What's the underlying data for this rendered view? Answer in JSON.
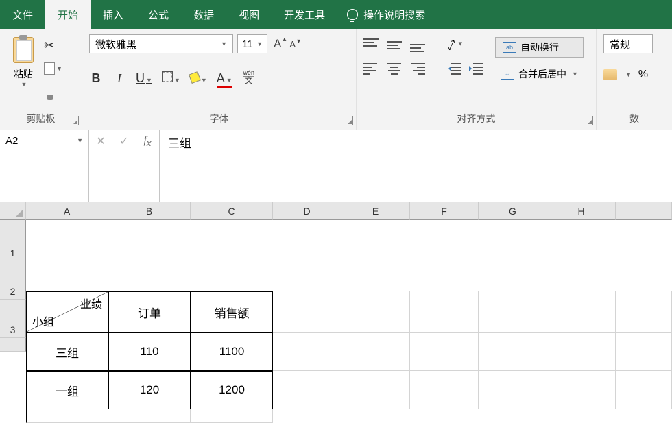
{
  "menu": {
    "items": [
      "文件",
      "开始",
      "插入",
      "公式",
      "数据",
      "视图",
      "开发工具"
    ],
    "active_index": 1,
    "search_placeholder": "操作说明搜索"
  },
  "ribbon": {
    "clipboard": {
      "paste": "粘贴",
      "label": "剪贴板"
    },
    "font": {
      "name": "微软雅黑",
      "size": "11",
      "bold": "B",
      "italic": "I",
      "underline": "U",
      "fontcolor_letter": "A",
      "wen": "wén",
      "wen_char": "文",
      "grow": "A",
      "shrink": "A",
      "label": "字体"
    },
    "alignment": {
      "wrap": "自动换行",
      "wrap_ic": "ab",
      "merge": "合并后居中",
      "label": "对齐方式"
    },
    "number": {
      "format": "常规",
      "percent": "%",
      "label": "数"
    }
  },
  "formula_bar": {
    "name_box": "A2",
    "value": "三组"
  },
  "grid": {
    "columns": [
      "A",
      "B",
      "C",
      "D",
      "E",
      "F",
      "G",
      "H",
      ""
    ],
    "rows": [
      "1",
      "2",
      "3",
      ""
    ],
    "data": {
      "A1_top": "业绩",
      "A1_bottom": "小组",
      "B1": "订单",
      "C1": "销售额",
      "A2": "三组",
      "B2": "110",
      "C2": "1100",
      "A3": "一组",
      "B3": "120",
      "C3": "1200"
    }
  }
}
